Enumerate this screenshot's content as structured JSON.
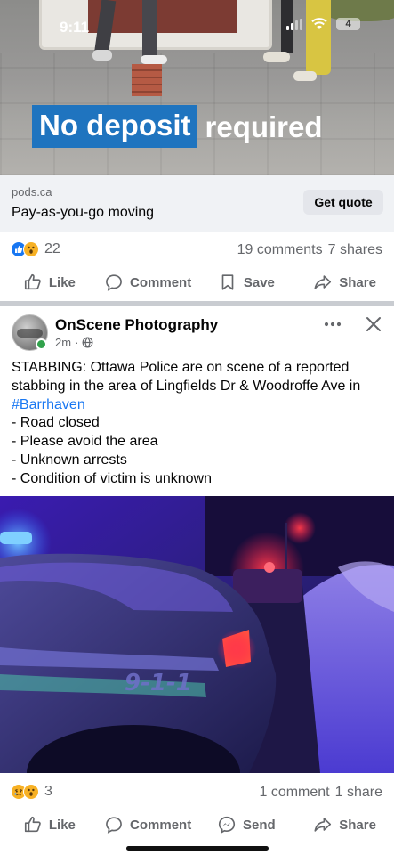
{
  "status_bar": {
    "time": "9:11",
    "battery": "4"
  },
  "ad": {
    "headline_highlight": "No deposit",
    "headline_rest": "required",
    "domain": "pods.ca",
    "title": "Pay-as-you-go moving",
    "cta_label": "Get quote",
    "reactions": {
      "icons": [
        "like-icon",
        "wow-icon"
      ],
      "count": "22"
    },
    "comments": "19 comments",
    "shares": "7 shares",
    "actions": {
      "like": "Like",
      "comment": "Comment",
      "save": "Save",
      "share": "Share"
    }
  },
  "post": {
    "page_name": "OnScene Photography",
    "time": "2m",
    "dot": "·",
    "text_lead": "STABBING: Ottawa Police are on scene of a reported stabbing in the area of Lingfields Dr & Woodroffe Ave in",
    "hashtag": "#Barrhaven",
    "bullets": [
      "- Road closed",
      "- Please avoid the area",
      "- Unknown arrests",
      "- Condition of victim is unknown"
    ],
    "photo_text": "9-1-1",
    "reactions": {
      "icons": [
        "sad-icon",
        "wow-icon"
      ],
      "count": "3"
    },
    "comments": "1 comment",
    "shares": "1 share",
    "actions": {
      "like": "Like",
      "comment": "Comment",
      "send": "Send",
      "share": "Share"
    }
  },
  "colors": {
    "accent": "#1877f2",
    "headline_box": "#1f74bf",
    "online": "#31a24c",
    "muted_text": "#65676b"
  }
}
